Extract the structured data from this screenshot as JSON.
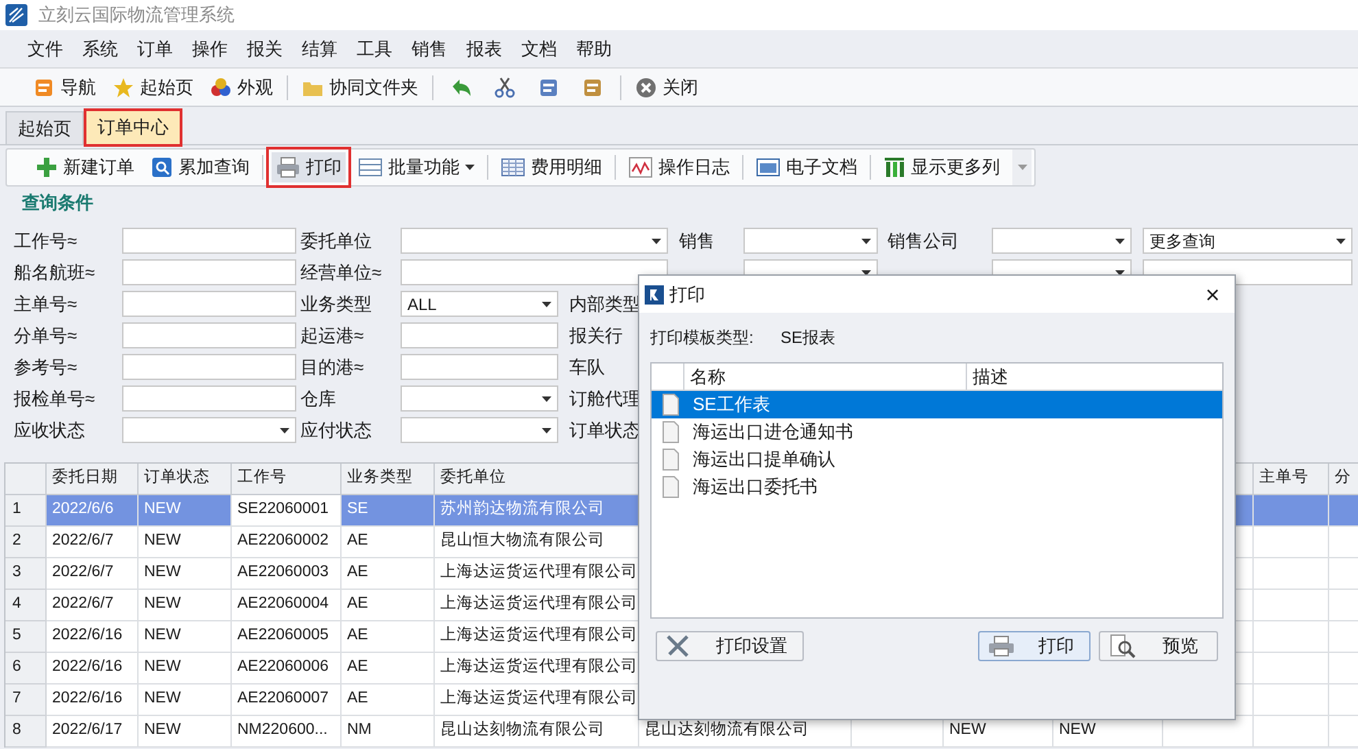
{
  "window": {
    "title": "立刻云国际物流管理系统"
  },
  "menu": [
    "文件",
    "系统",
    "订单",
    "操作",
    "报关",
    "结算",
    "工具",
    "销售",
    "报表",
    "文档",
    "帮助"
  ],
  "toolbar": [
    {
      "kind": "button",
      "label": "导航"
    },
    {
      "kind": "button",
      "label": "起始页"
    },
    {
      "kind": "button",
      "label": "外观"
    },
    {
      "kind": "separator"
    },
    {
      "kind": "button",
      "label": "协同文件夹"
    },
    {
      "kind": "separator"
    },
    {
      "kind": "icon-button"
    },
    {
      "kind": "icon-button"
    },
    {
      "kind": "icon-button"
    },
    {
      "kind": "icon-button"
    },
    {
      "kind": "separator"
    },
    {
      "kind": "button",
      "label": "关闭"
    }
  ],
  "tabs": [
    {
      "label": "起始页",
      "selected": false,
      "highlighted": false
    },
    {
      "label": "订单中心",
      "selected": true,
      "highlighted": true
    }
  ],
  "order_toolbar": [
    {
      "kind": "button",
      "label": "新建订单",
      "highlighted": false
    },
    {
      "kind": "button",
      "label": "累加查询",
      "highlighted": false
    },
    {
      "kind": "separator"
    },
    {
      "kind": "button",
      "label": "打印",
      "highlighted": true
    },
    {
      "kind": "menu-button",
      "label": "批量功能",
      "highlighted": false
    },
    {
      "kind": "separator"
    },
    {
      "kind": "button",
      "label": "费用明细",
      "highlighted": false
    },
    {
      "kind": "separator"
    },
    {
      "kind": "button",
      "label": "操作日志",
      "highlighted": false
    },
    {
      "kind": "separator"
    },
    {
      "kind": "button",
      "label": "电子文档",
      "highlighted": false
    },
    {
      "kind": "separator"
    },
    {
      "kind": "button",
      "label": "显示更多列",
      "highlighted": false
    }
  ],
  "query": {
    "title": "查询条件",
    "rows": [
      [
        {
          "label": "工作号≈",
          "kind": "text"
        },
        {
          "label": "委托单位",
          "kind": "wide-dropdown"
        },
        {
          "label": "销售",
          "kind": "dropdown"
        },
        {
          "label": "销售公司",
          "kind": "dropdown"
        },
        {
          "kind": "dropdown",
          "value": "更多查询"
        }
      ],
      [
        {
          "label": "船名航班≈",
          "kind": "text"
        },
        {
          "label": "经营单位≈",
          "kind": "wide-text"
        },
        {
          "kind": "dropdown"
        },
        {
          "kind": "dropdown"
        },
        {
          "kind": "text"
        }
      ],
      [
        {
          "label": "主单号≈",
          "kind": "text"
        },
        {
          "label": "业务类型",
          "kind": "dropdown",
          "value": "ALL"
        },
        {
          "label": "内部类型",
          "kind": "hidden"
        }
      ],
      [
        {
          "label": "分单号≈",
          "kind": "text"
        },
        {
          "label": "起运港≈",
          "kind": "text"
        },
        {
          "label": "报关行",
          "kind": "hidden"
        }
      ],
      [
        {
          "label": "参考号≈",
          "kind": "text"
        },
        {
          "label": "目的港≈",
          "kind": "text"
        },
        {
          "label": "车队",
          "kind": "hidden"
        }
      ],
      [
        {
          "label": "报检单号≈",
          "kind": "text"
        },
        {
          "label": "仓库",
          "kind": "dropdown"
        },
        {
          "label": "订舱代理",
          "kind": "hidden"
        }
      ],
      [
        {
          "label": "应收状态",
          "kind": "dropdown"
        },
        {
          "label": "应付状态",
          "kind": "dropdown"
        },
        {
          "label": "订单状态",
          "kind": "hidden"
        }
      ]
    ]
  },
  "table": {
    "columns": [
      "委托日期",
      "订单状态",
      "工作号",
      "业务类型",
      "委托单位",
      null,
      null,
      null,
      null,
      null,
      "主单号",
      "分"
    ],
    "rows": [
      {
        "num": "1",
        "selected": true,
        "cells": [
          "2022/6/6",
          "NEW",
          "SE22060001",
          "SE",
          "苏州韵达物流有限公司",
          null,
          null,
          null,
          null,
          null,
          null,
          null
        ]
      },
      {
        "num": "2",
        "selected": false,
        "cells": [
          "2022/6/7",
          "NEW",
          "AE22060002",
          "AE",
          "昆山恒大物流有限公司",
          null,
          null,
          null,
          null,
          null,
          null,
          null
        ]
      },
      {
        "num": "3",
        "selected": false,
        "cells": [
          "2022/6/7",
          "NEW",
          "AE22060003",
          "AE",
          "上海达运货运代理有限公司",
          null,
          null,
          null,
          null,
          null,
          null,
          null
        ]
      },
      {
        "num": "4",
        "selected": false,
        "cells": [
          "2022/6/7",
          "NEW",
          "AE22060004",
          "AE",
          "上海达运货运代理有限公司",
          null,
          null,
          null,
          null,
          null,
          null,
          null
        ]
      },
      {
        "num": "5",
        "selected": false,
        "cells": [
          "2022/6/16",
          "NEW",
          "AE22060005",
          "AE",
          "上海达运货运代理有限公司",
          null,
          null,
          null,
          null,
          null,
          null,
          null
        ]
      },
      {
        "num": "6",
        "selected": false,
        "cells": [
          "2022/6/16",
          "NEW",
          "AE22060006",
          "AE",
          "上海达运货运代理有限公司",
          null,
          null,
          null,
          null,
          null,
          null,
          null
        ]
      },
      {
        "num": "7",
        "selected": false,
        "cells": [
          "2022/6/16",
          "NEW",
          "AE22060007",
          "AE",
          "上海达运货运代理有限公司",
          null,
          null,
          null,
          null,
          null,
          null,
          null
        ]
      },
      {
        "num": "8",
        "selected": false,
        "cells": [
          "2022/6/17",
          "NEW",
          "NM220600...",
          "NM",
          "昆山达刻物流有限公司",
          "昆山达刻物流有限公司",
          null,
          "NEW",
          "NEW",
          null,
          null,
          null
        ]
      }
    ]
  },
  "dialog": {
    "title": "打印",
    "close": "×",
    "template_label": "打印模板类型:",
    "template_value": "SE报表",
    "columns": [
      "名称",
      "描述"
    ],
    "templates": [
      {
        "name": "SE工作表",
        "selected": true
      },
      {
        "name": "海运出口进仓通知书",
        "selected": false
      },
      {
        "name": "海运出口提单确认",
        "selected": false
      },
      {
        "name": "海运出口委托书",
        "selected": false
      }
    ],
    "buttons": [
      {
        "label": "打印设置",
        "kind": "settings"
      },
      {
        "label": "打印",
        "kind": "print"
      },
      {
        "label": "预览",
        "kind": "preview"
      }
    ]
  }
}
